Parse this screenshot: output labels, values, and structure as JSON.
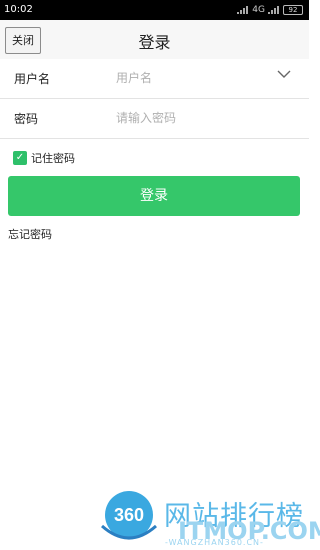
{
  "status_bar": {
    "time": "10:02",
    "network": "4G",
    "battery": "92"
  },
  "header": {
    "close_label": "关闭",
    "title": "登录"
  },
  "form": {
    "username": {
      "label": "用户名",
      "placeholder": "用户名",
      "value": ""
    },
    "password": {
      "label": "密码",
      "placeholder": "请输入密码",
      "value": ""
    },
    "remember": {
      "label": "记住密码",
      "checked": true
    },
    "login_label": "登录",
    "forgot_label": "忘记密码"
  },
  "colors": {
    "accent_green": "#35c76a",
    "checkbox_green": "#2ec06a"
  },
  "watermark": {
    "logo_text": "360",
    "cn_text": "网站排行榜",
    "site": "ITMOP.COM",
    "sub": "-WANGZHAN360.CN-"
  }
}
